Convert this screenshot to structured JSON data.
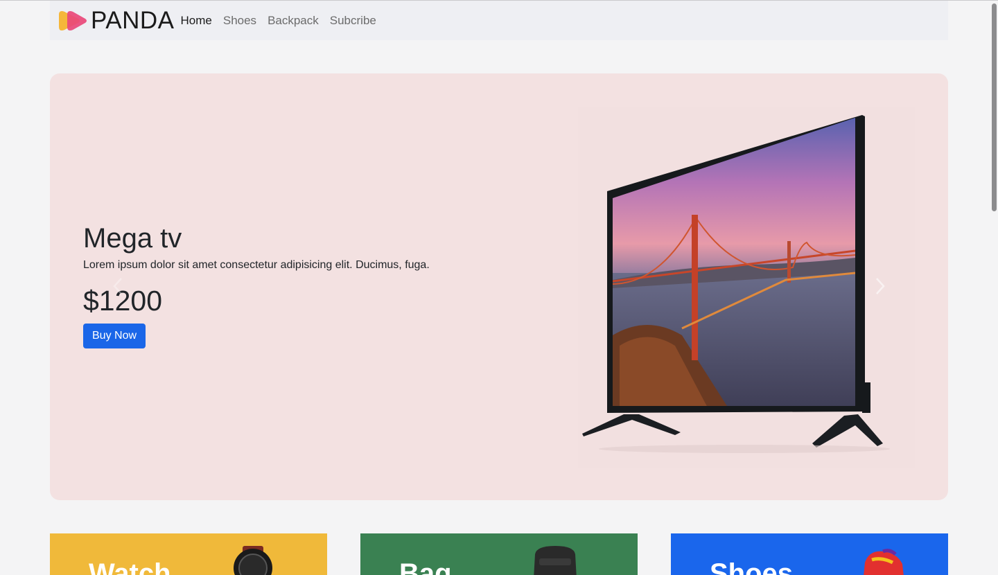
{
  "brand": {
    "name": "PANDA",
    "logo_icon": "play-arrows-logo-icon"
  },
  "nav": {
    "items": [
      {
        "label": "Home",
        "active": true
      },
      {
        "label": "Shoes",
        "active": false
      },
      {
        "label": "Backpack",
        "active": false
      },
      {
        "label": "Subcribe",
        "active": false
      }
    ]
  },
  "hero": {
    "title": "Mega tv",
    "description": "Lorem ipsum dolor sit amet consectetur adipisicing elit. Ducimus, fuga.",
    "price": "$1200",
    "cta_label": "Buy Now",
    "prev_icon": "chevron-left-icon",
    "next_icon": "chevron-right-icon"
  },
  "categories": [
    {
      "title": "Watch",
      "color": "#f0b93a",
      "image": "wristwatch"
    },
    {
      "title": "Bag",
      "color": "#3a8152",
      "image": "backpack"
    },
    {
      "title": "Shoes",
      "color": "#1a66ec",
      "image": "sneaker"
    }
  ],
  "colors": {
    "hero_bg": "#f3e1e1",
    "primary_button": "#1a66e8",
    "navbar_bg": "#eeeff3",
    "page_bg": "#f4f4f5"
  }
}
